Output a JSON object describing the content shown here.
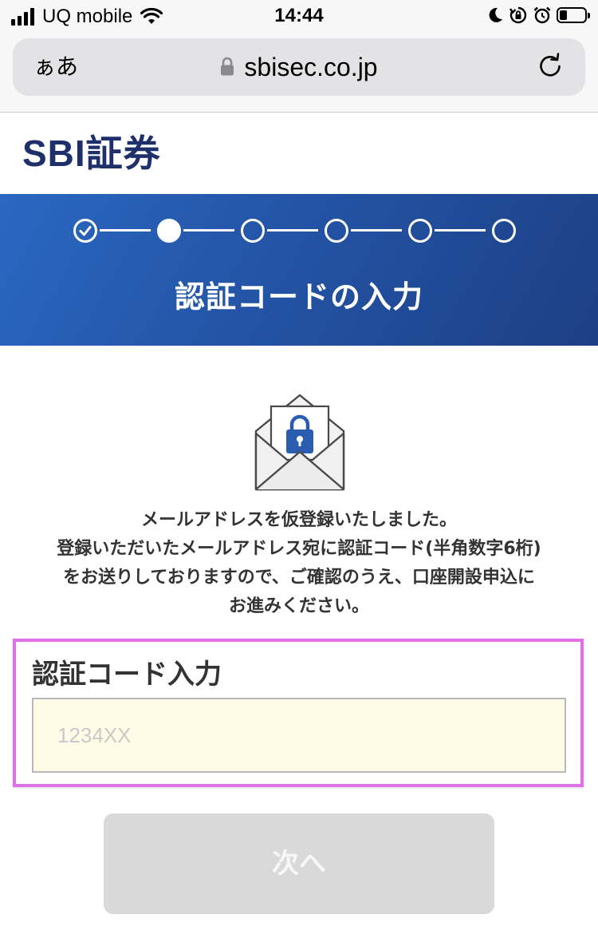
{
  "status_bar": {
    "carrier": "UQ mobile",
    "time": "14:44",
    "battery_level": 0.3
  },
  "browser": {
    "reader_button": "ぁあ",
    "url": "sbisec.co.jp"
  },
  "header": {
    "logo_text": "SBI証券"
  },
  "banner": {
    "steps_total": 6,
    "steps_completed": 1,
    "current_step": 2,
    "title": "認証コードの入力"
  },
  "message": {
    "lines": [
      "メールアドレスを仮登録いたしました。",
      "登録いただいたメールアドレス宛に認証コード(半角数字6桁)",
      "をお送りしておりますので、ご確認のうえ、口座開設申込に",
      "お進みください。"
    ]
  },
  "code_form": {
    "label": "認証コード入力",
    "value": "",
    "placeholder": "1234XX",
    "highlight_color": "#e070e8"
  },
  "next_button": {
    "label": "次へ",
    "disabled": true
  },
  "colors": {
    "brand_navy": "#1e2f6a",
    "banner_blue": "#2456a9",
    "input_bg": "#fffbe6",
    "button_disabled": "#d9d9d9",
    "envelope_lock": "#2a5db0"
  },
  "icons": {
    "signal": "cellular-signal-icon",
    "wifi": "wifi-icon",
    "moon": "do-not-disturb-moon-icon",
    "rotation_lock": "rotation-lock-icon",
    "alarm": "alarm-clock-icon",
    "battery": "battery-icon",
    "lock": "padlock-icon",
    "reload": "reload-icon",
    "envelope": "envelope-lock-icon"
  }
}
